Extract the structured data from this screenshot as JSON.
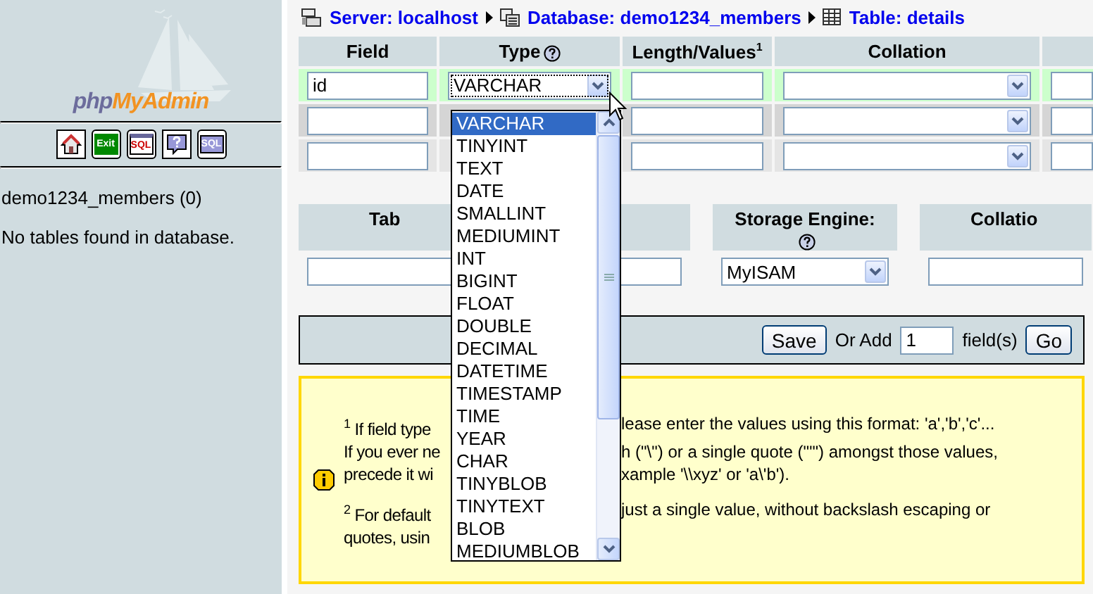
{
  "sidebar": {
    "logo": {
      "text_1": "php",
      "text_2": "MyAdmin"
    },
    "nav_icons": [
      {
        "kind": "home"
      },
      {
        "kind": "exit",
        "label": "Exit"
      },
      {
        "kind": "sql",
        "label": "SQL"
      },
      {
        "kind": "help"
      },
      {
        "kind": "query",
        "label": "SQL"
      }
    ],
    "database": "demo1234_members (0)",
    "message": "No tables found in database."
  },
  "breadcrumb": [
    {
      "kind": "server",
      "label": "Server: localhost"
    },
    {
      "kind": "database",
      "label": "Database: demo1234_members"
    },
    {
      "kind": "table",
      "label": "Table: details"
    }
  ],
  "fields_table": {
    "columns": [
      {
        "label": "Field"
      },
      {
        "label": "Type",
        "help": true
      },
      {
        "label": "Length/Values",
        "sup": "1"
      },
      {
        "label": "Collation"
      }
    ],
    "rows": [
      {
        "field": "id",
        "type": "VARCHAR",
        "highlighted": true
      },
      {
        "highlighted": false
      },
      {
        "highlighted": false
      }
    ]
  },
  "type_dropdown": {
    "options": [
      {
        "label": "VARCHAR",
        "selected": true
      },
      {
        "label": "TINYINT",
        "selected": false
      },
      {
        "label": "TEXT",
        "selected": false
      },
      {
        "label": "DATE",
        "selected": false
      },
      {
        "label": "SMALLINT",
        "selected": false
      },
      {
        "label": "MEDIUMINT",
        "selected": false
      },
      {
        "label": "INT",
        "selected": false
      },
      {
        "label": "BIGINT",
        "selected": false
      },
      {
        "label": "FLOAT",
        "selected": false
      },
      {
        "label": "DOUBLE",
        "selected": false
      },
      {
        "label": "DECIMAL",
        "selected": false
      },
      {
        "label": "DATETIME",
        "selected": false
      },
      {
        "label": "TIMESTAMP",
        "selected": false
      },
      {
        "label": "TIME",
        "selected": false
      },
      {
        "label": "YEAR",
        "selected": false
      },
      {
        "label": "CHAR",
        "selected": false
      },
      {
        "label": "TINYBLOB",
        "selected": false
      },
      {
        "label": "TINYTEXT",
        "selected": false
      },
      {
        "label": "BLOB",
        "selected": false
      },
      {
        "label": "MEDIUMBLOB",
        "selected": false
      }
    ]
  },
  "table_options": {
    "headers": [
      {
        "label": "Tab"
      },
      {
        "label": "Storage Engine:",
        "help": true
      },
      {
        "label": "Collatio"
      }
    ],
    "storage_engine": "MyISAM"
  },
  "save_bar": {
    "save": "Save",
    "or_add": "Or Add",
    "count": "1",
    "unit": "field(s)",
    "go": "Go"
  },
  "notes": [
    {
      "sup": "1",
      "lines": [
        {
          "left": "If field type",
          "right": "lease enter the values using this format: 'a','b','c'..."
        },
        {
          "left": "If you ever ne",
          "right": "h (\"\\\") or a single quote (\"'\") amongst those values,"
        },
        {
          "left": "precede it wi",
          "right": "xample '\\\\xyz' or 'a\\'b')."
        }
      ]
    },
    {
      "sup": "2",
      "lines": [
        {
          "left": "For default",
          "right": "just a single value, without backslash escaping or"
        },
        {
          "left": "quotes, usin"
        }
      ]
    }
  ]
}
